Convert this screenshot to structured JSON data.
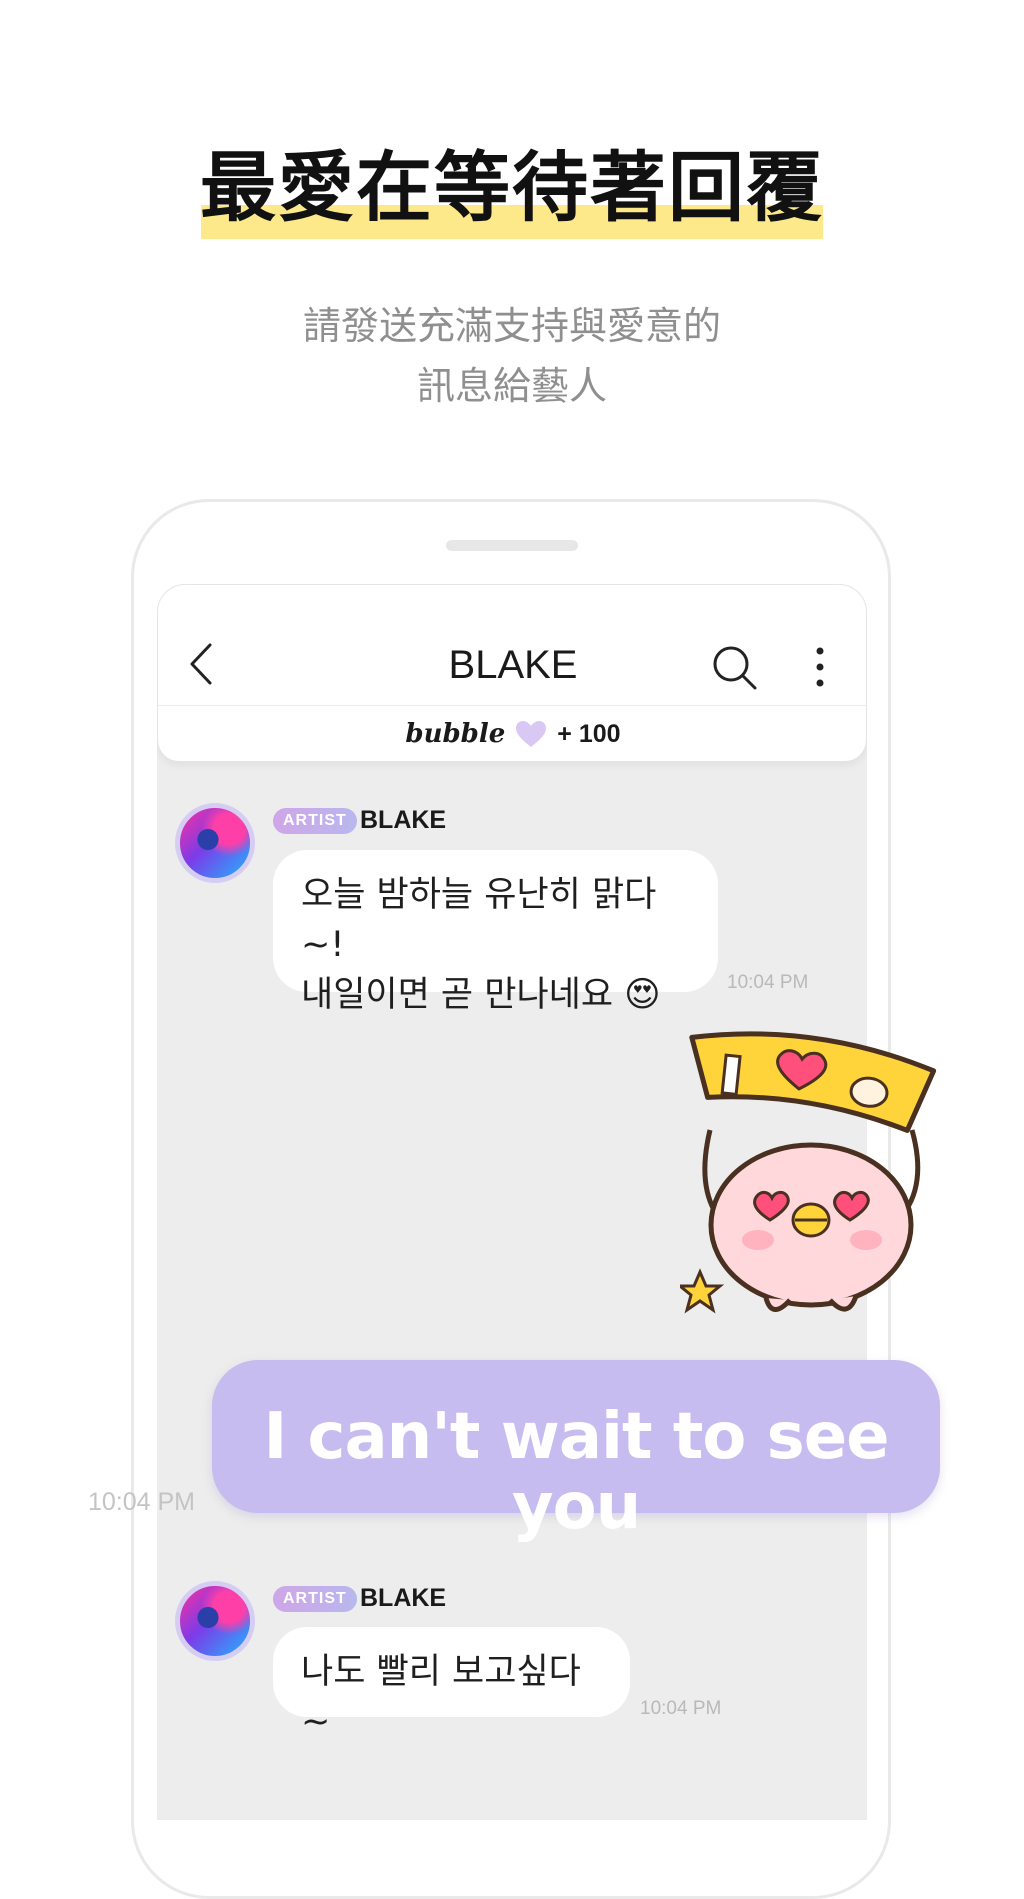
{
  "promo": {
    "headline": "最愛在等待著回覆",
    "subtitle_line1": "請發送充滿支持與愛意的",
    "subtitle_line2": "訊息給藝人"
  },
  "chat_header": {
    "title": "BLAKE",
    "bubble_logo": "bubble",
    "bubble_count": "+ 100",
    "icons": [
      "chevron-left-icon",
      "search-icon",
      "more-vertical-icon",
      "heart-icon"
    ]
  },
  "messages": [
    {
      "badge": "ARTIST",
      "sender": "BLAKE",
      "text": "오늘 밤하늘 유난히 맑다~!\n내일이면 곧 만나네요 😍",
      "time": "10:04 PM"
    },
    {
      "badge": "ARTIST",
      "sender": "BLAKE",
      "text": "나도 빨리 보고싶다~",
      "time": "10:04 PM"
    }
  ],
  "outgoing": {
    "text": "I can't wait to see you",
    "time": "10:04 PM"
  },
  "colors": {
    "highlight": "#fde98a",
    "chat_bg": "#ededed",
    "outgoing_bubble": "#c6bcef",
    "badge_gradient": "#cfa6e8"
  }
}
